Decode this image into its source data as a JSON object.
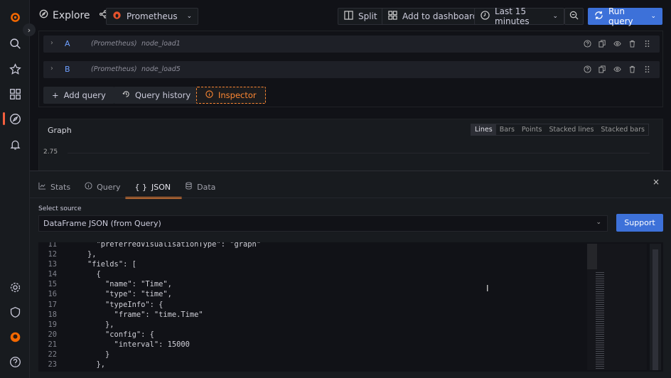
{
  "sidebar": {
    "items": [
      {
        "icon": "grafana-logo-icon"
      },
      {
        "icon": "search-icon"
      },
      {
        "icon": "star-icon"
      },
      {
        "icon": "dashboards-icon"
      },
      {
        "icon": "explore-compass-icon",
        "active": true
      },
      {
        "icon": "bell-icon"
      },
      {
        "icon": "gear-icon"
      },
      {
        "icon": "shield-icon"
      },
      {
        "icon": "avatar-icon"
      },
      {
        "icon": "help-icon"
      }
    ],
    "accent": "#f55f3e"
  },
  "header": {
    "title": "Explore",
    "datasource": "Prometheus",
    "split": "Split",
    "add_to_dashboard": "Add to dashboard",
    "time_range": "Last 15 minutes",
    "run_query": "Run query"
  },
  "queries": [
    {
      "ref": "A",
      "datasource": "(Prometheus)",
      "expr": "node_load1"
    },
    {
      "ref": "B",
      "datasource": "(Prometheus)",
      "expr": "node_load5"
    }
  ],
  "actions": {
    "add_query": "Add query",
    "query_history": "Query history",
    "inspector": "Inspector"
  },
  "graph": {
    "title": "Graph",
    "modes": [
      "Lines",
      "Bars",
      "Points",
      "Stacked lines",
      "Stacked bars"
    ],
    "active_mode": "Lines",
    "y_tick": "2.75"
  },
  "inspector": {
    "tabs": [
      "Stats",
      "Query",
      "JSON",
      "Data"
    ],
    "active_tab": "JSON",
    "select_label": "Select source",
    "select_value": "DataFrame JSON (from Query)",
    "support": "Support",
    "code": [
      {
        "n": "11",
        "t": "      \"preferredVisualisationType\": \"graph\""
      },
      {
        "n": "12",
        "t": "    },"
      },
      {
        "n": "13",
        "t": "    \"fields\": ["
      },
      {
        "n": "14",
        "t": "      {"
      },
      {
        "n": "15",
        "t": "        \"name\": \"Time\","
      },
      {
        "n": "16",
        "t": "        \"type\": \"time\","
      },
      {
        "n": "17",
        "t": "        \"typeInfo\": {"
      },
      {
        "n": "18",
        "t": "          \"frame\": \"time.Time\""
      },
      {
        "n": "19",
        "t": "        },"
      },
      {
        "n": "20",
        "t": "        \"config\": {"
      },
      {
        "n": "21",
        "t": "          \"interval\": 15000"
      },
      {
        "n": "22",
        "t": "        }"
      },
      {
        "n": "23",
        "t": "      },"
      }
    ]
  },
  "colors": {
    "primary": "#3d71d9",
    "inspector_accent": "#ff8833",
    "tab_underline": "#f08134"
  }
}
